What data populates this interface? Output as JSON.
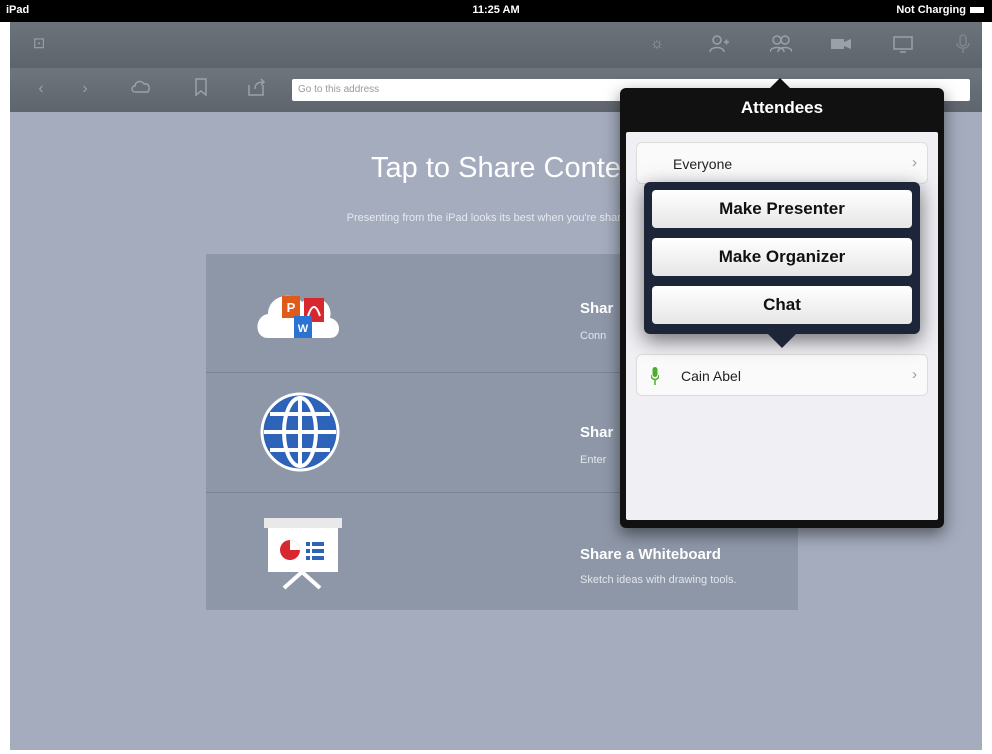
{
  "status_bar": {
    "device": "iPad",
    "time": "11:25 AM",
    "battery": "Not Charging"
  },
  "address_bar": {
    "placeholder": "Go to this address"
  },
  "main": {
    "title": "Tap to Share Conte",
    "subtitle": "Presenting from the iPad looks its best when you're sharing F"
  },
  "share_options": [
    {
      "title": "Shar",
      "desc": "Conn",
      "icon": "cloud-documents-icon"
    },
    {
      "title": "Shar",
      "desc": "Enter",
      "icon": "globe-icon"
    },
    {
      "title": "Share a Whiteboard",
      "desc": "Sketch ideas with drawing tools.",
      "icon": "whiteboard-icon"
    }
  ],
  "popover": {
    "title": "Attendees",
    "items": [
      {
        "label": "Everyone"
      },
      {
        "label": "Cain Abel",
        "icon": "microphone-icon"
      }
    ]
  },
  "action_menu": {
    "make_presenter": "Make Presenter",
    "make_organizer": "Make Organizer",
    "chat": "Chat"
  },
  "colors": {
    "content_bg": "#a4acbd",
    "toolbar_bg": "#666c74",
    "mic_green": "#4cae2a",
    "menu_bg": "#1d2638"
  }
}
